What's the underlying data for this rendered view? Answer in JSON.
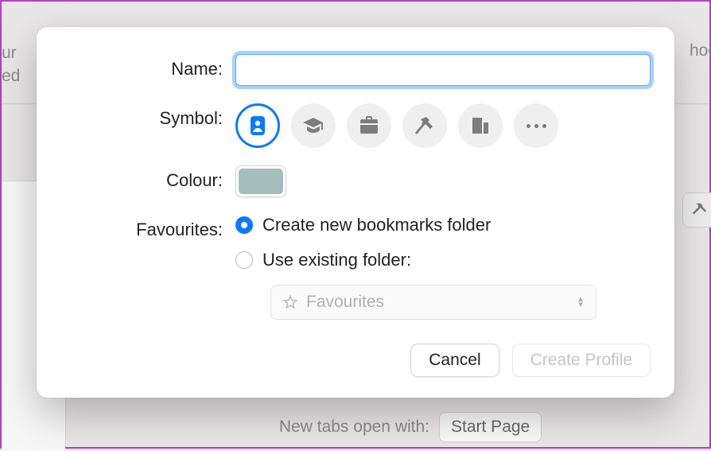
{
  "background": {
    "left_text_line1": "ur",
    "left_text_line2": "ed",
    "right_text": "hoo",
    "bottom_label": "New tabs open with:",
    "bottom_value": "Start Page"
  },
  "modal": {
    "name": {
      "label": "Name:",
      "value": ""
    },
    "symbol": {
      "label": "Symbol:",
      "options": [
        "badge",
        "graduation",
        "briefcase",
        "hammer",
        "building",
        "more"
      ],
      "selected_index": 0
    },
    "colour": {
      "label": "Colour:",
      "value": "#a6bdbe"
    },
    "favourites": {
      "label": "Favourites:",
      "options": [
        {
          "label": "Create new bookmarks folder",
          "checked": true
        },
        {
          "label": "Use existing folder:",
          "checked": false
        }
      ],
      "folder_select": {
        "placeholder": "Favourites"
      }
    },
    "buttons": {
      "cancel": "Cancel",
      "create": "Create Profile"
    }
  }
}
